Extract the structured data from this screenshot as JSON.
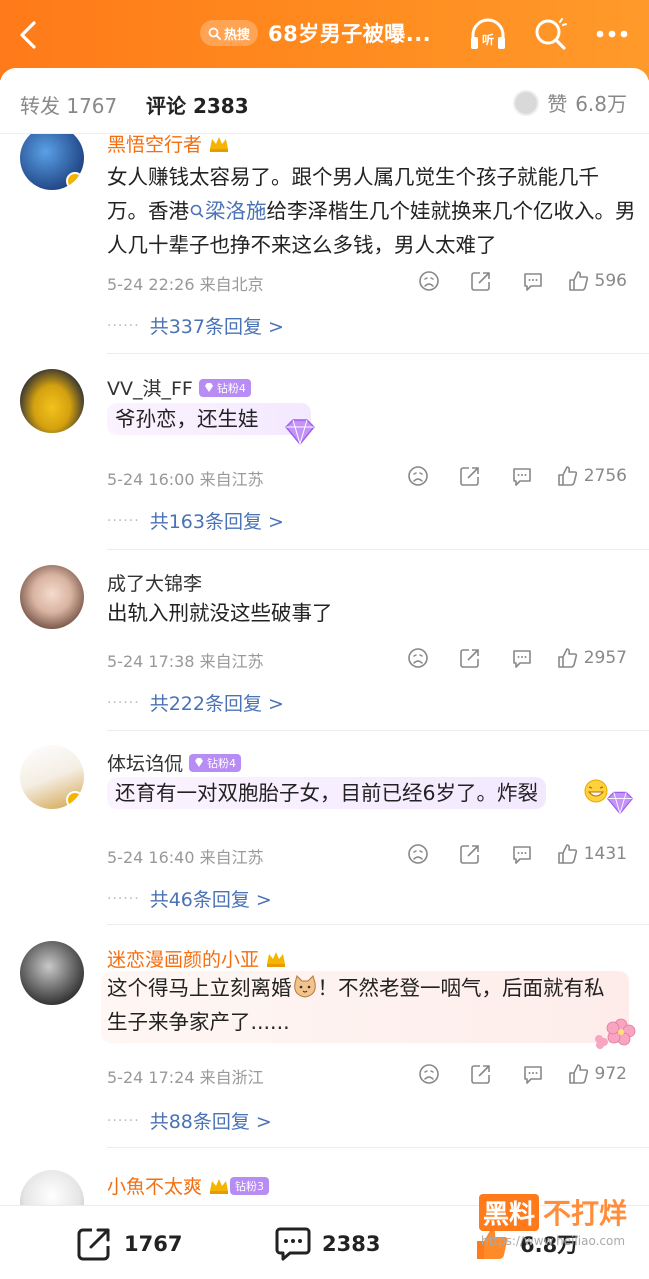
{
  "header": {
    "hot_label": "热搜",
    "title": "68岁男子被曝...",
    "colors": {
      "bar": "#ff7a1a",
      "text": "#ffffff"
    }
  },
  "tabs": {
    "repost_label": "转发",
    "repost_count": "1767",
    "comment_label": "评论",
    "comment_count": "2383",
    "like_label": "赞",
    "like_count": "6.8万"
  },
  "comments": [
    {
      "user": "黑悟空行者",
      "text_before": "女人赚钱太容易了。跟个男人属几觉生个孩子就能几千万。香港",
      "topic": "梁洛施",
      "text_after": "给李泽楷生几个娃就换来几个亿收入。男人几十辈子也挣不来这么多钱，男人太难了",
      "meta": "5-24 22:26  来自北京",
      "likes": "596",
      "replies": "共337条回复 >"
    },
    {
      "user": "VV_淇_FF",
      "badge": "钻粉4",
      "text": "爷孙恋，还生娃",
      "meta": "5-24 16:00  来自江苏",
      "likes": "2756",
      "replies": "共163条回复 >"
    },
    {
      "user": "成了大锦李",
      "text": "出轨入刑就没这些破事了",
      "meta": "5-24 17:38  来自江苏",
      "likes": "2957",
      "replies": "共222条回复 >"
    },
    {
      "user": "体坛诌侃",
      "badge": "钻粉4",
      "text": "还育有一对双胞胎子女，目前已经6岁了。炸裂",
      "meta": "5-24 16:40  来自江苏",
      "likes": "1431",
      "replies": "共46条回复 >"
    },
    {
      "user": "迷恋漫画颜的小亚",
      "text_before": "这个得马上立刻离婚",
      "text_after": "！不然老登一咽气，后面就有私生子来争家产了......",
      "meta": "5-24 17:24  来自浙江",
      "likes": "972",
      "replies": "共88条回复 >"
    },
    {
      "user": "小魚不太爽",
      "badge": "钻粉3"
    }
  ],
  "bottom": {
    "repost_count": "1767",
    "comment_count": "2383",
    "like_count": "6.8万"
  },
  "watermark": {
    "part_a": "黑料",
    "part_b": "不打烊",
    "url": "https://www.heiliao.com"
  },
  "icons": [
    "back-icon",
    "search-icon",
    "headphones-icon",
    "more-icon",
    "sad-face-icon",
    "share-icon",
    "comment-icon",
    "thumb-up-icon"
  ]
}
